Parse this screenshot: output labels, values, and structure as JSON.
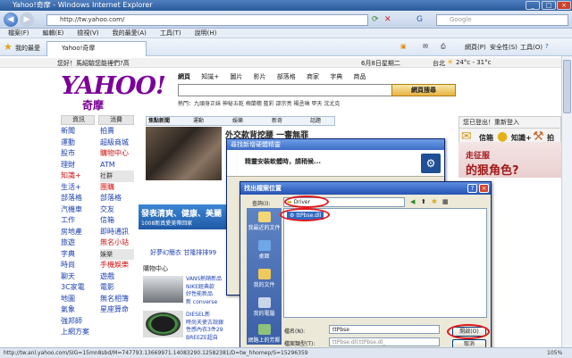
{
  "window": {
    "title": "Yahoo!奇摩 - Windows Internet Explorer"
  },
  "address": {
    "url": "http://tw.yahoo.com/",
    "search_placeholder": "Google"
  },
  "menu": {
    "items": [
      "檔案(F)",
      "編輯(E)",
      "檢視(V)",
      "我的最愛(A)",
      "工具(T)",
      "說明(H)"
    ]
  },
  "favorites": {
    "label": "我的最愛",
    "tab": "Yahoo!奇摩",
    "tools": [
      "網頁(P)",
      "安全性(S)",
      "工具(O)"
    ]
  },
  "page": {
    "topline": "您好！馬紹驗您能裡們?高",
    "date": "6月8日星期二",
    "weather_city": "台北",
    "weather": "24°c - 31°c",
    "logo": "YAHOO!",
    "logo_sub": "奇摩",
    "search_tabs": [
      "網頁",
      "知識+",
      "圖片",
      "影片",
      "部落格",
      "商家",
      "字典",
      "商品"
    ],
    "search_button": "網頁搜尋",
    "hot": "熱門：九頭身正妹 神秘五乾 梅蘭穗 藍彩 邵宗亮 楊丞琳 甲天 沈尤克",
    "left_header": "資訊",
    "left_items": [
      "新聞",
      "運動",
      "股市",
      "理財",
      "知識+",
      "生活+",
      "部落格",
      "汽機車",
      "工作",
      "房地產",
      "旅遊",
      "字典",
      "時尚",
      "聊天",
      "3C家電",
      "地圖",
      "氣象",
      "強邦師",
      "上網方案"
    ],
    "right_header": "消費",
    "right_items": [
      "拍賣",
      "超級商城",
      "購物中心",
      "ATM",
      "社群",
      "團購",
      "部落格",
      "交友",
      "信箱",
      "即時通訊",
      "無名小站",
      "娛樂",
      "手機娛樂",
      "遊戲",
      "電影",
      "無名相簿",
      "星座算命"
    ],
    "news_tabs": [
      "焦點新聞",
      "運動",
      "娛樂",
      "新奇",
      "話題"
    ],
    "headline": "外交款背挖腰 一審無罪",
    "right_login": "您已登出！重新登入",
    "right_links": [
      "信箱",
      "知識+",
      "拍賣"
    ],
    "ad_text": "的狠角色?",
    "ad_pre": "走征服",
    "blue_ad": "發表清爽、健康、美麗",
    "blue_ad_sub": "1008新真愛美帶回家",
    "fun": "好夢幻簡衣 甘隆排排99",
    "shop_header": "購物中心",
    "shop_items": [
      "VANS熱銷新品",
      "NIKE經典款",
      "好性能新品",
      "新 converse",
      "DIESEL新",
      "時尚天使古說銀",
      "性感內衣3件29",
      "BREEZE超自"
    ]
  },
  "dialog1": {
    "title": "尋找新增硬體精靈",
    "message": "精靈安裝軟體時，請稍候..."
  },
  "dialog2": {
    "title": "找出檔案位置",
    "look_in_label": "查詢(I):",
    "look_in_value": "Driver",
    "file": "ttPbse.dll",
    "places": [
      "我最近的文件",
      "桌面",
      "我的文件",
      "我的電腦",
      "網路上的芳鄰"
    ],
    "filename_label": "檔名(N):",
    "filename_value": "ttPbse",
    "filetype_label": "檔案類型(T):",
    "filetype_value": "ttPbse.dll;ttPbse.dl_",
    "open": "開啟(O)",
    "cancel": "取消"
  },
  "status": {
    "text": "http://tw.anl.yahoo.com/SIG=15mn8sbd/M=747793.13669971.14083290.12582381/D=tw_hhomep/S=15296359",
    "zoom": "105%"
  }
}
